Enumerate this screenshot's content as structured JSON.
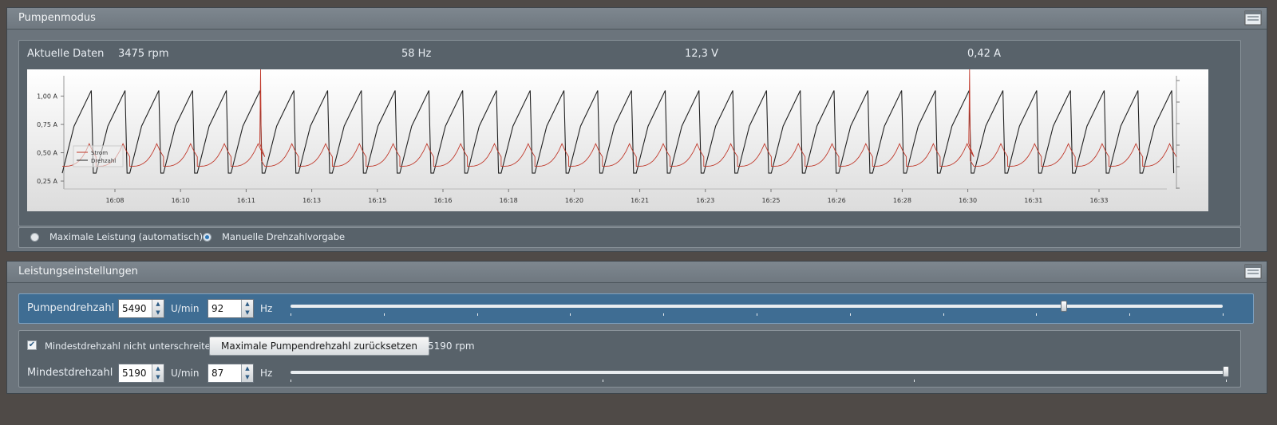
{
  "panel1": {
    "title": "Pumpenmodus",
    "current_data": {
      "label": "Aktuelle Daten",
      "rpm": "3475 rpm",
      "freq": "58 Hz",
      "voltage": "12,3 V",
      "current": "0,42 A"
    },
    "modes": [
      {
        "label": "Maximale Leistung (automatisch)",
        "selected": false
      },
      {
        "label": "Manuelle Drehzahlvorgabe",
        "selected": true
      }
    ]
  },
  "panel2": {
    "title": "Leistungseinstellungen",
    "pump_speed": {
      "label": "Pumpendrehzahl",
      "rpm_value": "5490",
      "rpm_unit": "U/min",
      "hz_value": "92",
      "hz_unit": "Hz",
      "slider_fraction": 0.83
    },
    "min_speed": {
      "checkbox_label": "Mindestdrehzahl nicht unterschreiten",
      "checked": true,
      "reset_button": "Maximale Pumpendrehzahl zurücksetzen",
      "reset_value": "5190 rpm",
      "label": "Mindestdrehzahl",
      "rpm_value": "5190",
      "rpm_unit": "U/min",
      "hz_value": "87",
      "hz_unit": "Hz",
      "slider_fraction": 1.0
    }
  },
  "chart_data": {
    "type": "line",
    "x_ticks": [
      "16:08",
      "16:10",
      "16:11",
      "16:13",
      "16:15",
      "16:16",
      "16:18",
      "16:20",
      "16:21",
      "16:23",
      "16:25",
      "16:26",
      "16:28",
      "16:30",
      "16:31",
      "16:33"
    ],
    "y_ticks": [
      "1,00 A",
      "0,75 A",
      "0,50 A",
      "0,25 A"
    ],
    "ylim": [
      0.18,
      1.18
    ],
    "legend": [
      {
        "name": "Strom",
        "color": "#c0392b"
      },
      {
        "name": "Drehzahl",
        "color": "#222222"
      }
    ],
    "legend_position": "left",
    "series": [
      {
        "name": "Strom",
        "pattern": "periodic peaks",
        "cycles": 33,
        "baseline": 0.38,
        "peak": 0.58,
        "spikes_at_cycle": [
          5,
          26
        ]
      },
      {
        "name": "Drehzahl",
        "pattern": "sawtooth",
        "cycles": 33,
        "low": 0.32,
        "high": 1.05
      }
    ]
  }
}
